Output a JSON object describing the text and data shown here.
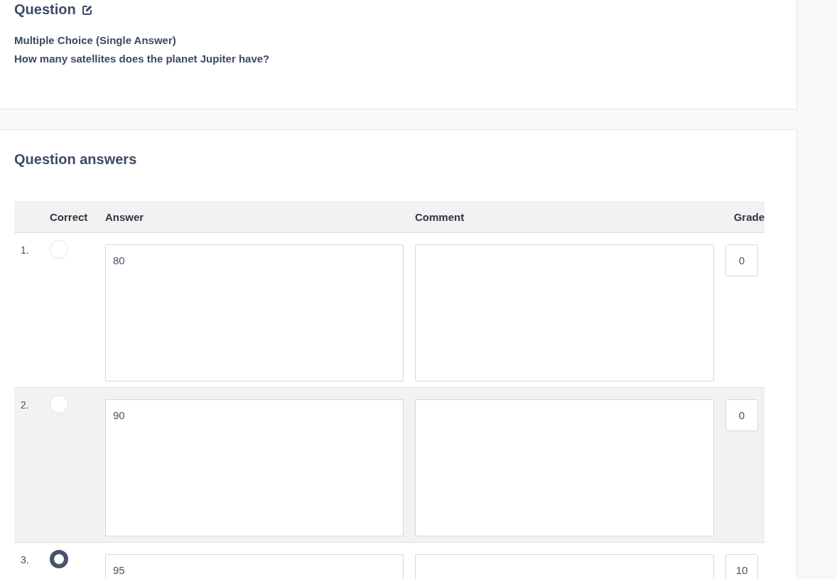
{
  "question": {
    "title": "Question",
    "type": "Multiple Choice (Single Answer)",
    "text": "How many satellites does the planet Jupiter have?"
  },
  "answers": {
    "title": "Question answers",
    "columns": [
      "Correct",
      "Answer",
      "Comment",
      "Grade"
    ],
    "rows": [
      {
        "number": "1.",
        "selected": false,
        "answer": "80",
        "grade": "0"
      },
      {
        "number": "2.",
        "selected": false,
        "answer": "90",
        "grade": "0"
      },
      {
        "number": "3.",
        "selected": true,
        "answer": "95",
        "grade": "10"
      }
    ]
  }
}
